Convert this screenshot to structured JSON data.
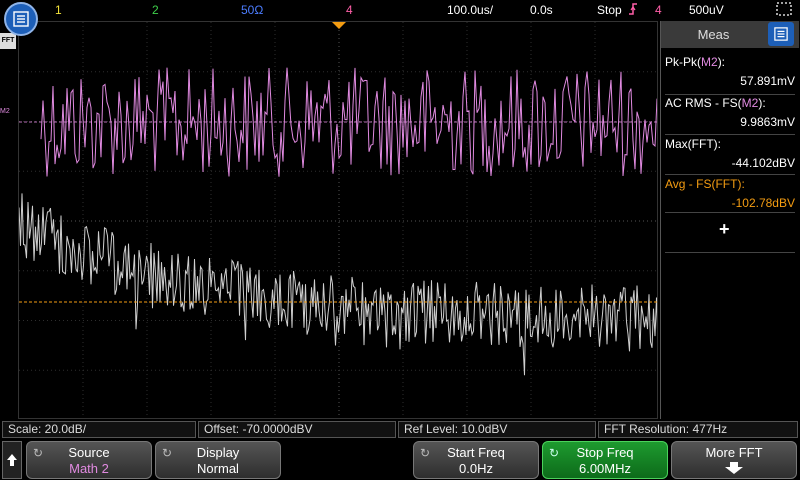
{
  "topbar": {
    "ch1": "1",
    "ch2": "2",
    "ch3": "50Ω",
    "ch4": "4",
    "timebase": "100.0us/",
    "delay": "0.0s",
    "run_state": "Stop",
    "trigger_source": "4",
    "trigger_level": "500uV"
  },
  "labels": {
    "fft": "FFT",
    "m2": "M2"
  },
  "meas": {
    "title": "Meas",
    "items": [
      {
        "name": "Pk-Pk",
        "src": "M2",
        "value": "57.891mV"
      },
      {
        "name": "AC RMS - FS",
        "src": "M2",
        "value": "9.9863mV"
      },
      {
        "name": "Max(FFT):",
        "value": "-44.102dBV"
      },
      {
        "name": "Avg - FS(FFT):",
        "value": "-102.78dBV"
      }
    ],
    "add": "+"
  },
  "infobar": {
    "scale": "Scale: 20.0dB/",
    "offset": "Offset: -70.0000dBV",
    "ref_level": "Ref Level: 10.0dBV",
    "resolution": "FFT Resolution: 477Hz"
  },
  "softkeys": {
    "source_title": "Source",
    "source_value": "Math 2",
    "display_title": "Display",
    "display_value": "Normal",
    "start_title": "Start Freq",
    "start_value": "0.0Hz",
    "stop_title": "Stop Freq",
    "stop_value": "6.00MHz",
    "more_title": "More FFT"
  },
  "colors": {
    "ch1": "#f2e23a",
    "ch2": "#3ecf4a",
    "ch3": "#4c7dff",
    "ch4": "#ff5fa8",
    "math2": "#e08ae0",
    "fft": "#cfcfcf",
    "accent": "#f39c12"
  }
}
